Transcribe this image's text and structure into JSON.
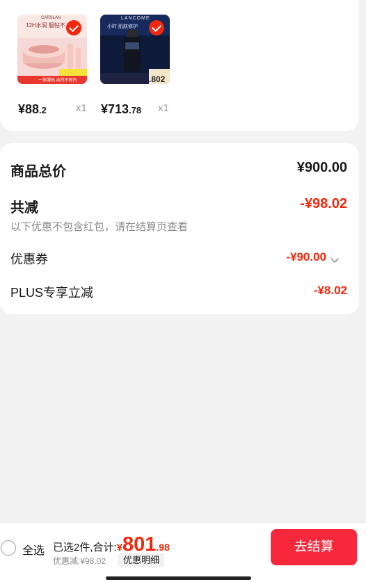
{
  "products": [
    {
      "brand_logo_text": "CARSLAN",
      "headline": "12H水润 服帖不",
      "price_yen": "¥",
      "price_int": "88",
      "price_dec": ".2",
      "qty": "x1",
      "badge_text": "一抹服帖 自然不假白",
      "selected": true
    },
    {
      "brand_logo_text": "LANCOME",
      "headline": "小时 肌肤修护",
      "price_yen": "¥",
      "price_int": "713",
      "price_dec": ".78",
      "qty": "x1",
      "thumb_price_partial": ".802",
      "selected": true
    }
  ],
  "summary": {
    "total_label": "商品总价",
    "total_value": "¥900.00",
    "reduce_label": "共减",
    "reduce_value": "-¥98.02",
    "note": "以下优惠不包含红包，请在结算页查看",
    "coupon_label": "优惠券",
    "coupon_value": "-¥90.00",
    "plus_label": "PLUS专享立减",
    "plus_value": "-¥8.02"
  },
  "bottom": {
    "select_all": "全选",
    "total_prefix": "已选2件,合计:",
    "yen": "¥",
    "total_int": "801",
    "total_dec": ".98",
    "discount_text": "优惠减:¥98.02",
    "detail_button": "优惠明细",
    "checkout_button": "去结算"
  },
  "colors": {
    "accent": "#f2270c",
    "checkout_bg": "#f8283c",
    "background": "#f2f2f2"
  }
}
